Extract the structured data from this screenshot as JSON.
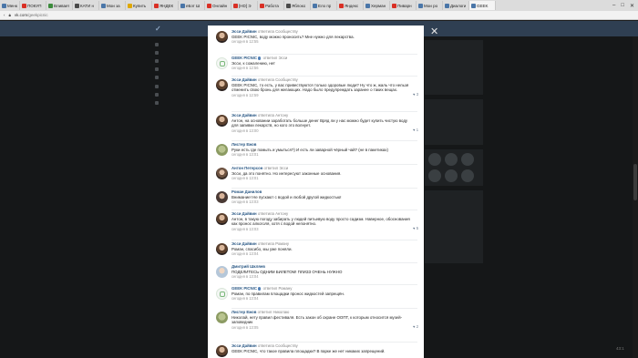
{
  "browser": {
    "tabs": [
      {
        "label": "Меню",
        "color": "#4a76a8"
      },
      {
        "label": "ПОКУП",
        "color": "#d93025"
      },
      {
        "label": "Вливает",
        "color": "#3c8b3c"
      },
      {
        "label": "КАТИ н",
        "color": "#4a4a4a"
      },
      {
        "label": "Мои за",
        "color": "#4a76a8"
      },
      {
        "label": "Купить",
        "color": "#e0a800"
      },
      {
        "label": "ЯНДЕК",
        "color": "#d93025"
      },
      {
        "label": "еБэт Ш",
        "color": "#4a76a8"
      },
      {
        "label": "Онлайн",
        "color": "#d93025"
      },
      {
        "label": "[HD] Э",
        "color": "#d93025"
      },
      {
        "label": "Работа",
        "color": "#d93025"
      },
      {
        "label": "Яблоко",
        "color": "#4a4a4a"
      },
      {
        "label": "Ело пр",
        "color": "#4a76a8"
      },
      {
        "label": "Яндекс",
        "color": "#d93025"
      },
      {
        "label": "Херман",
        "color": "#4a76a8"
      },
      {
        "label": "Пиварн",
        "color": "#d93025"
      },
      {
        "label": "Мои ро",
        "color": "#4a76a8"
      },
      {
        "label": "Диалоги",
        "color": "#4a76a8"
      },
      {
        "label": "GEEK",
        "color": "#4a76a8"
      }
    ],
    "url_host": "vk.com",
    "url_path": "/geekpicnic"
  },
  "comments": [
    {
      "author": "Эсси Дайвин",
      "reply": "ответила Сообществу",
      "text": "GEEK PICNIC, воду можно проносить? Мне нужно для лекарства.",
      "date": "сегодня в 12:55",
      "avatar": "photo-a",
      "likes": ""
    },
    {
      "author": "GEEK PICNIC",
      "reply": "ответил Эсси",
      "text": "Эсси, к сожалению, нет",
      "date": "сегодня в 12:56",
      "avatar": "logo",
      "likes": ""
    },
    {
      "author": "Эсси Дайвин",
      "reply": "ответила Сообществу",
      "text": "GEEK PICNIC, то есть, у вас привествуются только здоровые люди? Ну что ж, жаль что нельзя отменить свою бронь для желающих. Надо было предупреждать заранее о таких вещах.",
      "date": "сегодня в 12:59",
      "avatar": "photo-a",
      "likes": "3"
    },
    {
      "author": "Эсси Дайвин",
      "reply": "ответила Антону",
      "text": "Антон, на основании заработать больше денег Вряд ли у нас можно будет купить чистую воду для запивки лекарств, но кого это волнует.",
      "date": "сегодня в 13:00",
      "avatar": "photo-a",
      "likes": "1"
    },
    {
      "author": "Листер Ежов",
      "reply": "",
      "text": "Руки есть где помыть и умыться?) И есть ли заварной чёрный чай? (не в пакетиках)",
      "date": "сегодня в 13:01",
      "avatar": "cartoon",
      "likes": ""
    },
    {
      "author": "Антон Петерсон",
      "reply": "ответил Эсси",
      "text": "Эсси, да это понятно. Но интересуют законные основания.",
      "date": "сегодня в 13:01",
      "avatar": "photo-b",
      "likes": ""
    },
    {
      "author": "Роман Данилов",
      "reply": "",
      "text": "Внимание! Не пускают с водой и любой другой жидкостью!",
      "date": "сегодня в 13:03",
      "avatar": "photo-c",
      "likes": ""
    },
    {
      "author": "Эсси Дайвин",
      "reply": "ответила Антону",
      "text": "Антон, в такую погоду забирать у людей питьевую воду просто садизм. Наверное, обоснования как пронос алкоголя, хотя с водой непонятно.",
      "date": "сегодня в 13:03",
      "avatar": "photo-a",
      "likes": "5"
    },
    {
      "author": "Эсси Дайвин",
      "reply": "ответила Роману",
      "text": "Роман, спасибо, мы уже поняли.",
      "date": "сегодня в 13:04",
      "avatar": "photo-a",
      "likes": ""
    },
    {
      "author": "Дмитрий Шкляев",
      "reply": "",
      "text": "ПОДЕЛИТЕСЬ ОДНИМ БИЛЕТОМ! ПЛИЗЗ ОЧЕНЬ НУЖНО",
      "date": "сегодня в 13:04",
      "avatar": "photo-d",
      "likes": ""
    },
    {
      "author": "GEEK PICNIC",
      "reply": "ответил Роману",
      "text": "Роман, по правилам площадки пронос жидкостей запрещён.",
      "date": "сегодня в 13:04",
      "avatar": "logo",
      "likes": ""
    },
    {
      "author": "Листер Ежов",
      "reply": "ответил Николаю",
      "text": "Николай, нету правил фестиваля. Есть закон об охране ООПТ, к которым относится музей-заповедник",
      "date": "сегодня в 13:05",
      "avatar": "cartoon",
      "likes": "2"
    },
    {
      "author": "Эсси Дайвин",
      "reply": "ответила Сообществу",
      "text": "GEEK PICNIC, что такое правила площадки? В парке же нет никаких запрещений.",
      "date": "",
      "avatar": "photo-a",
      "likes": ""
    }
  ],
  "corner_text": "43:1"
}
